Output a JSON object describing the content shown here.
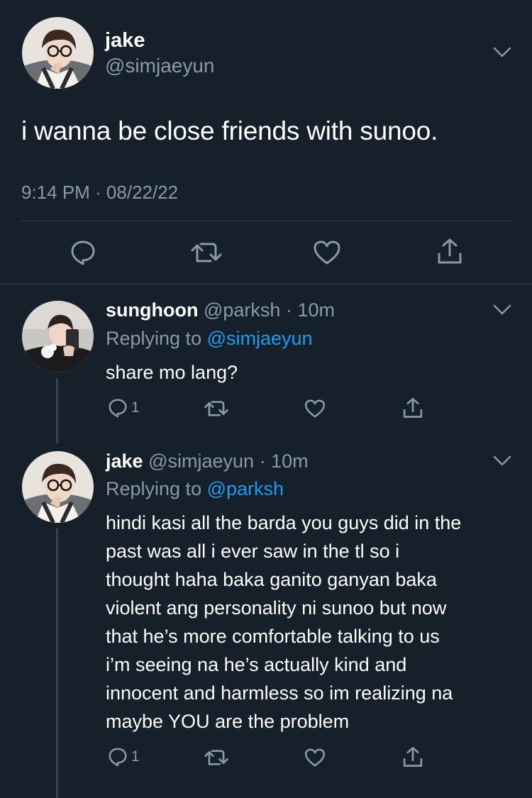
{
  "main_tweet": {
    "author_name": "jake",
    "author_handle": "@simjaeyun",
    "text": "i wanna be close friends with sunoo.",
    "timestamp": "9:14 PM · 08/22/22",
    "actions": [
      "reply-icon",
      "retweet-icon",
      "like-icon",
      "share-icon"
    ]
  },
  "replies": [
    {
      "author_name": "sunghoon",
      "author_handle": "@parksh",
      "time": "· 10m",
      "replying_label": "Replying to",
      "replying_to": "@simjaeyun",
      "text": "share mo lang?",
      "reply_count": "1"
    },
    {
      "author_name": "jake",
      "author_handle": "@simjaeyun",
      "time": "· 10m",
      "replying_label": "Replying to",
      "replying_to": "@parksh",
      "text_lines": [
        "hindi kasi all the barda you guys did in the",
        "past was all i ever saw in the tl so i",
        "thought haha baka ganito ganyan baka",
        "violent ang personality ni sunoo but now",
        "that he’s more comfortable talking to us",
        "i’m seeing na he’s actually kind and",
        "innocent and harmless so im realizing na",
        "maybe YOU are the problem"
      ],
      "reply_count": "1"
    }
  ],
  "colors": {
    "background": "#15202b",
    "muted_text": "#8b98a5",
    "link": "#1d9bf0",
    "divider": "#38444d"
  }
}
